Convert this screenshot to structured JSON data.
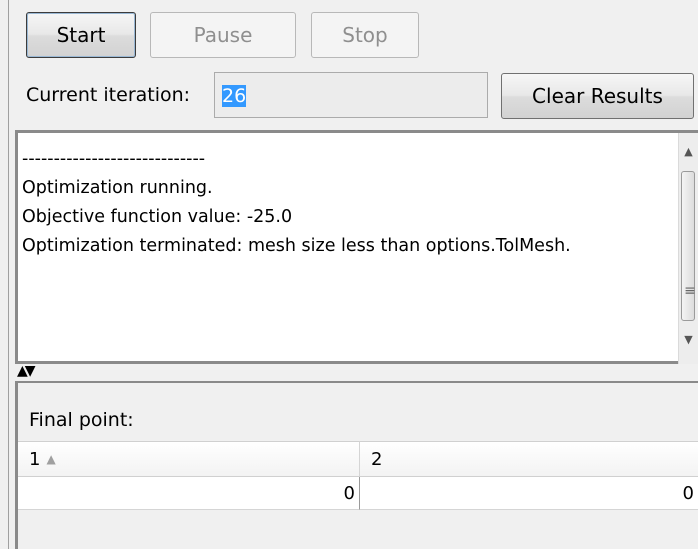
{
  "toolbar": {
    "start_label": "Start",
    "pause_label": "Pause",
    "stop_label": "Stop"
  },
  "iteration": {
    "label": "Current iteration:",
    "value": "26"
  },
  "clear_results_label": "Clear Results",
  "output_log": {
    "lines": [
      "-----------------------------",
      "Optimization running.",
      "Objective function value: -25.0",
      "Optimization terminated: mesh size less than options.TolMesh."
    ]
  },
  "final_point": {
    "title": "Final point:",
    "columns": [
      "1",
      "2"
    ],
    "values": [
      "0",
      "0"
    ]
  },
  "icons": {
    "scroll_up": "scroll-up-arrow-icon",
    "scroll_down": "scroll-down-arrow-icon",
    "splitter": "splitter-arrows-icon",
    "sort": "sort-ascending-icon"
  },
  "colors": {
    "selection": "#3399ff",
    "background": "#f0f0f0"
  }
}
